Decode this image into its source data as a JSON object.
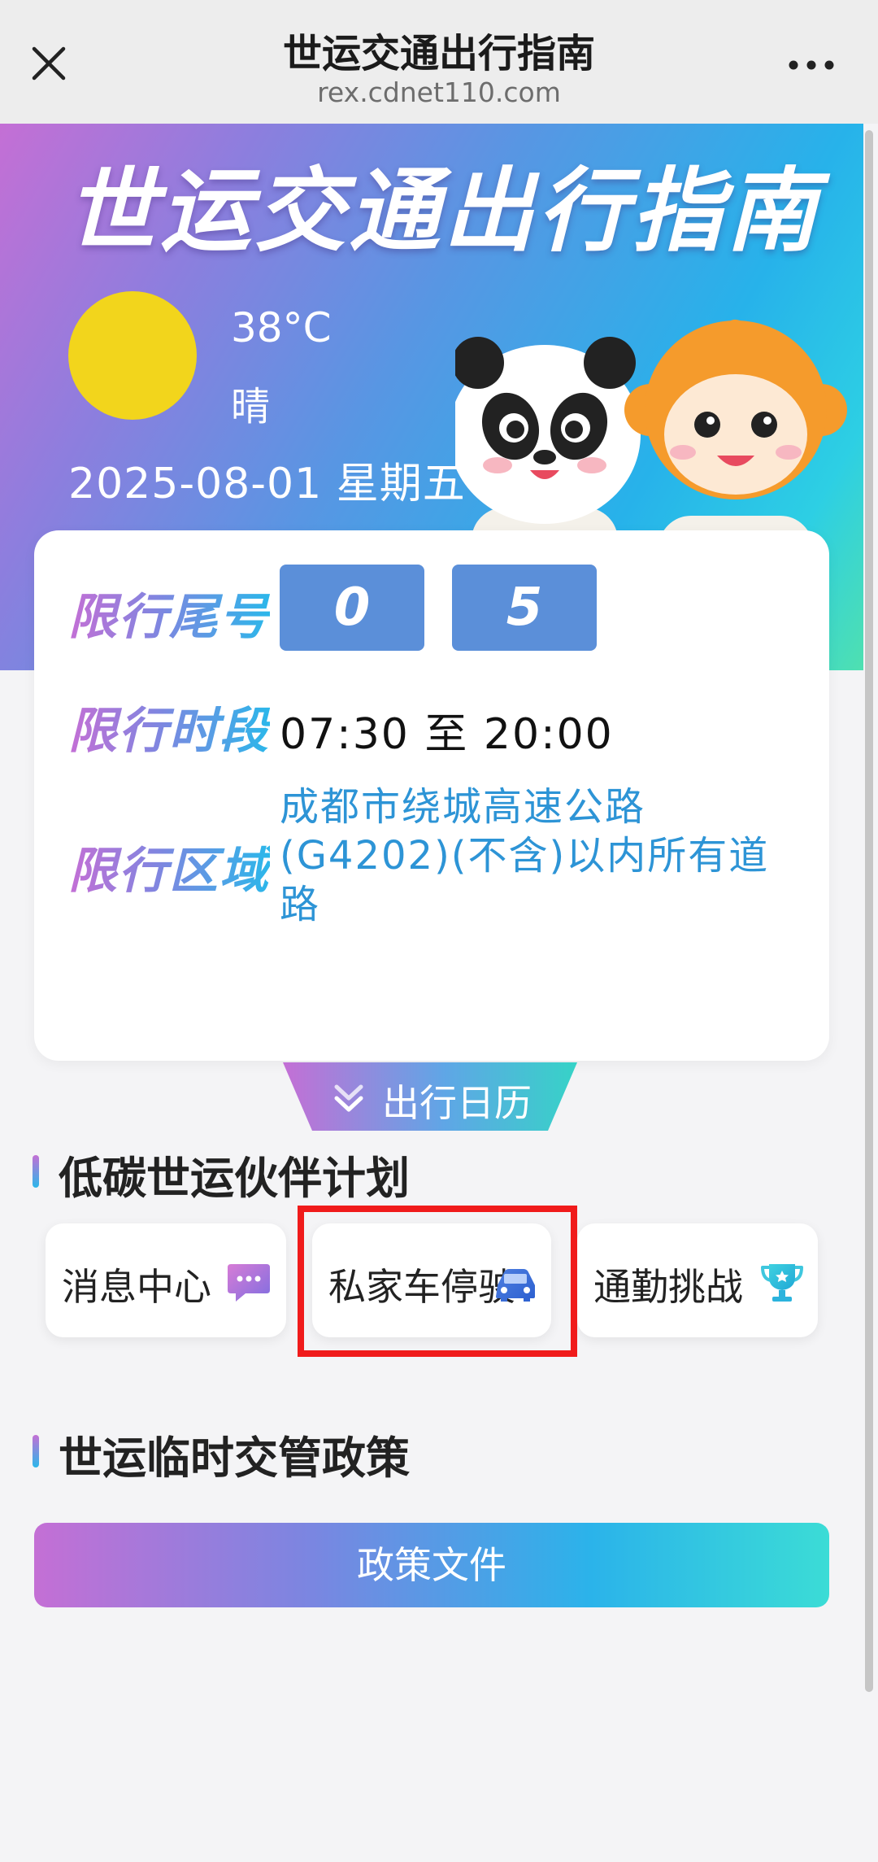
{
  "nav": {
    "title": "世运交通出行指南",
    "url": "rex.cdnet110.com"
  },
  "hero": {
    "title": "世运交通出行指南",
    "temperature": "38°C",
    "weather": "晴",
    "date": "2025-08-01  星期五"
  },
  "restriction": {
    "tail_label": "限行尾号",
    "digits": [
      "0",
      "5"
    ],
    "time_label": "限行时段",
    "time_value": "07:30  至 20:00",
    "area_label": "限行区域",
    "area_value": "成都市绕城高速公路(G4202)(不含)以内所有道路"
  },
  "calendar": {
    "label": "出行日历"
  },
  "partner_section": {
    "title": "低碳世运伙伴计划",
    "items": [
      {
        "label": "消息中心",
        "icon": "message-icon"
      },
      {
        "label": "私家车停驶",
        "icon": "car-icon"
      },
      {
        "label": "通勤挑战",
        "icon": "trophy-icon"
      }
    ]
  },
  "policy_section": {
    "title": "世运临时交管政策",
    "button_label": "政策文件"
  },
  "colors": {
    "digit_bg": "#5b8fd9",
    "area_text": "#2d94d6",
    "highlight": "#f01b1b",
    "sun": "#f2d51c"
  }
}
